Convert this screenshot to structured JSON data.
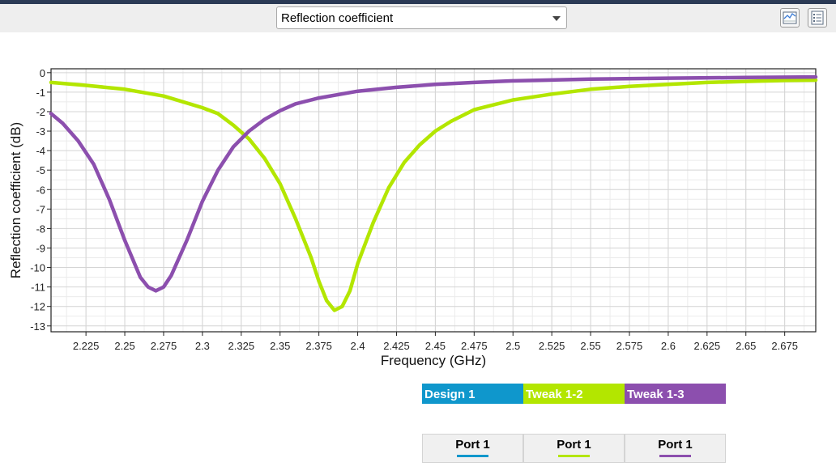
{
  "toolbar": {
    "plot_select": {
      "value": "Reflection coefficient"
    },
    "buttons": [
      {
        "icon": "plot-view-icon"
      },
      {
        "icon": "table-view-icon"
      }
    ]
  },
  "chart_data": {
    "type": "line",
    "xlabel": "Frequency (GHz)",
    "ylabel": "Reflection coefficient (dB)",
    "xlim": [
      2.2025,
      2.695
    ],
    "ylim": [
      -13.3,
      0.2
    ],
    "xticks": [
      "2.225",
      "2.25",
      "2.275",
      "2.3",
      "2.325",
      "2.35",
      "2.375",
      "2.4",
      "2.425",
      "2.45",
      "2.475",
      "2.5",
      "2.525",
      "2.55",
      "2.575",
      "2.6",
      "2.625",
      "2.65",
      "2.675"
    ],
    "yticks": [
      "0",
      "-1",
      "-2",
      "-3",
      "-4",
      "-5",
      "-6",
      "-7",
      "-8",
      "-9",
      "-10",
      "-11",
      "-12",
      "-13"
    ],
    "grid": true,
    "series": [
      {
        "name": "Tweak 1-2",
        "color": "#b3e600",
        "points": [
          [
            2.2025,
            -0.5
          ],
          [
            2.225,
            -0.65
          ],
          [
            2.25,
            -0.85
          ],
          [
            2.275,
            -1.2
          ],
          [
            2.3,
            -1.8
          ],
          [
            2.31,
            -2.1
          ],
          [
            2.32,
            -2.7
          ],
          [
            2.33,
            -3.4
          ],
          [
            2.34,
            -4.4
          ],
          [
            2.35,
            -5.7
          ],
          [
            2.36,
            -7.5
          ],
          [
            2.37,
            -9.5
          ],
          [
            2.375,
            -10.7
          ],
          [
            2.38,
            -11.7
          ],
          [
            2.385,
            -12.2
          ],
          [
            2.39,
            -12.0
          ],
          [
            2.395,
            -11.2
          ],
          [
            2.4,
            -9.8
          ],
          [
            2.41,
            -7.7
          ],
          [
            2.42,
            -5.9
          ],
          [
            2.43,
            -4.6
          ],
          [
            2.44,
            -3.7
          ],
          [
            2.45,
            -3.0
          ],
          [
            2.46,
            -2.5
          ],
          [
            2.475,
            -1.9
          ],
          [
            2.5,
            -1.4
          ],
          [
            2.525,
            -1.1
          ],
          [
            2.55,
            -0.85
          ],
          [
            2.575,
            -0.7
          ],
          [
            2.6,
            -0.6
          ],
          [
            2.625,
            -0.5
          ],
          [
            2.65,
            -0.45
          ],
          [
            2.675,
            -0.4
          ],
          [
            2.695,
            -0.38
          ]
        ]
      },
      {
        "name": "Tweak 1-3",
        "color": "#8c4fae",
        "points": [
          [
            2.2025,
            -2.1
          ],
          [
            2.21,
            -2.6
          ],
          [
            2.22,
            -3.5
          ],
          [
            2.23,
            -4.7
          ],
          [
            2.24,
            -6.5
          ],
          [
            2.25,
            -8.6
          ],
          [
            2.26,
            -10.5
          ],
          [
            2.265,
            -11.0
          ],
          [
            2.27,
            -11.2
          ],
          [
            2.275,
            -11.0
          ],
          [
            2.28,
            -10.4
          ],
          [
            2.29,
            -8.6
          ],
          [
            2.3,
            -6.6
          ],
          [
            2.31,
            -5.0
          ],
          [
            2.32,
            -3.8
          ],
          [
            2.33,
            -3.0
          ],
          [
            2.34,
            -2.4
          ],
          [
            2.35,
            -1.95
          ],
          [
            2.36,
            -1.6
          ],
          [
            2.375,
            -1.3
          ],
          [
            2.4,
            -0.95
          ],
          [
            2.425,
            -0.75
          ],
          [
            2.45,
            -0.6
          ],
          [
            2.475,
            -0.5
          ],
          [
            2.5,
            -0.42
          ],
          [
            2.55,
            -0.33
          ],
          [
            2.6,
            -0.28
          ],
          [
            2.65,
            -0.25
          ],
          [
            2.695,
            -0.22
          ]
        ]
      }
    ]
  },
  "legend": [
    {
      "label": "Design 1",
      "color": "#0f97cc"
    },
    {
      "label": "Tweak 1-2",
      "color": "#b3e600"
    },
    {
      "label": "Tweak 1-3",
      "color": "#8c4fae"
    }
  ],
  "ports": [
    {
      "label": "Port 1",
      "color": "#0f97cc"
    },
    {
      "label": "Port 1",
      "color": "#b3e600"
    },
    {
      "label": "Port 1",
      "color": "#8c4fae"
    }
  ]
}
